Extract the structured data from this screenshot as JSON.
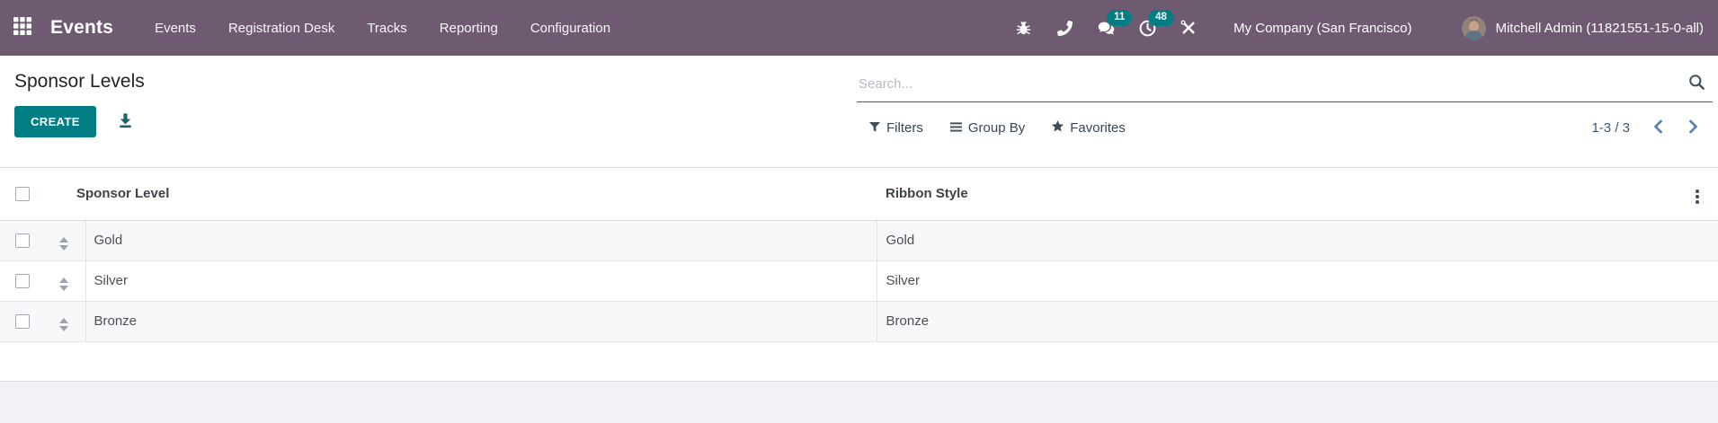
{
  "navbar": {
    "brand": "Events",
    "menu": [
      "Events",
      "Registration Desk",
      "Tracks",
      "Reporting",
      "Configuration"
    ],
    "badges": {
      "messages": "11",
      "activities": "48"
    },
    "company": "My Company (San Francisco)",
    "user": "Mitchell Admin (11821551-15-0-all)"
  },
  "control_panel": {
    "title": "Sponsor Levels",
    "create_label": "CREATE",
    "search_placeholder": "Search...",
    "filters_label": "Filters",
    "group_by_label": "Group By",
    "favorites_label": "Favorites",
    "pager": "1-3 / 3"
  },
  "table": {
    "columns": [
      "Sponsor Level",
      "Ribbon Style"
    ],
    "rows": [
      {
        "sponsor_level": "Gold",
        "ribbon_style": "Gold"
      },
      {
        "sponsor_level": "Silver",
        "ribbon_style": "Silver"
      },
      {
        "sponsor_level": "Bronze",
        "ribbon_style": "Bronze"
      }
    ]
  },
  "icons": {
    "apps": "grid",
    "debug": "bug",
    "voip": "phone",
    "messages": "chat-bubbles",
    "activities": "clock",
    "support_tools": "wrench-and-screwdriver",
    "search": "magnifier",
    "export": "download-arrow",
    "filters": "funnel",
    "group_by": "bars",
    "favorites": "star",
    "pager_prev": "chevron-left",
    "pager_next": "chevron-right",
    "row_handle": "up-down-triangles",
    "optional_columns": "vertical-ellipsis"
  },
  "colors": {
    "navbar": "#6e5b72",
    "accent": "#017e84",
    "pager_chevron": "#5d83b7",
    "row_stripe": "#f8f8fa",
    "page_background": "#f1f2f7"
  }
}
